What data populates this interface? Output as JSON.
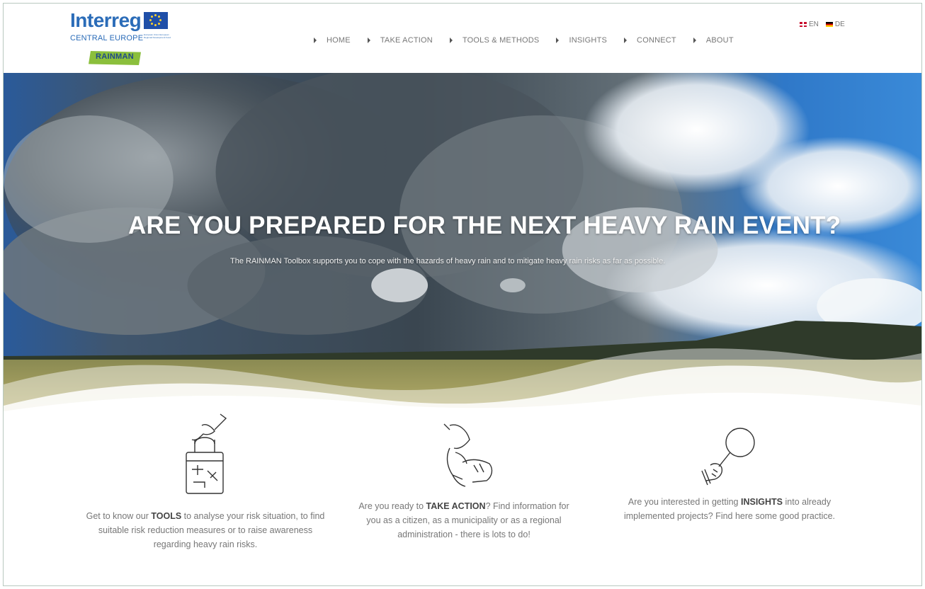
{
  "header": {
    "logo": {
      "word": "Interreg",
      "region": "CENTRAL EUROPE",
      "fine_print": "European Union European Regional Development Fund",
      "badge": "RAINMAN"
    },
    "nav": [
      {
        "label": "HOME"
      },
      {
        "label": "TAKE ACTION"
      },
      {
        "label": "TOOLS & METHODS"
      },
      {
        "label": "INSIGHTS"
      },
      {
        "label": "CONNECT"
      },
      {
        "label": "ABOUT"
      }
    ],
    "languages": [
      {
        "code": "EN",
        "flag": "uk-flag-icon"
      },
      {
        "code": "DE",
        "flag": "germany-flag-icon"
      }
    ]
  },
  "hero": {
    "title": "ARE YOU PREPARED FOR THE NEXT HEAVY RAIN EVENT?",
    "subtitle": "The RAINMAN Toolbox supports you to cope with the hazards of heavy rain and to mitigate heavy rain risks as far as possible."
  },
  "cards": [
    {
      "icon": "toolbox-hand-icon",
      "before": "Get to know our ",
      "bold": "TOOLS",
      "after": " to analyse your risk situation, to find suitable risk reduction measures or to raise awareness regarding heavy rain risks."
    },
    {
      "icon": "handshake-icon",
      "before": "Are you ready to ",
      "bold": "TAKE ACTION",
      "after": "? Find information for you as a citizen, as a municipality or as a regional administration - there is lots to do!"
    },
    {
      "icon": "magnifier-hand-icon",
      "before": "Are you interested in getting ",
      "bold": "INSIGHTS",
      "after": " into already implemented projects? Find here some good practice."
    }
  ],
  "colors": {
    "brand_blue": "#2b6cb8",
    "badge_green": "#8bbf3c",
    "text_gray": "#777777"
  }
}
